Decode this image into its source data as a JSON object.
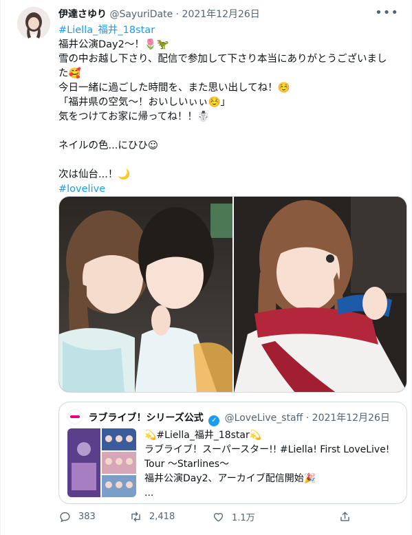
{
  "tweet": {
    "author": {
      "name": "伊達さゆり",
      "handle": "@SayuriDate",
      "separator": "·",
      "date": "2021年12月26日"
    },
    "body": [
      {
        "text": "#Liella_福井_18star",
        "type": "tag"
      },
      {
        "text": "福井公演Day2〜！🌷🦖",
        "type": "text"
      },
      {
        "text": "雪の中お越し下さり、配信で参加して下さり本当にありがとうございまし",
        "type": "text"
      },
      {
        "text": "た🥰",
        "type": "text"
      },
      {
        "text": "今日一緒に過ごした時間を、また思い出してね！☺️",
        "type": "text"
      },
      {
        "text": "「福井県の空気〜！おいしいぃぃ☺️」",
        "type": "text"
      },
      {
        "text": "気をつけてお家に帰ってね！！☃️",
        "type": "text"
      },
      {
        "text": "",
        "type": "text"
      },
      {
        "text": "ネイルの色...にひひ☺",
        "type": "text"
      },
      {
        "text": "",
        "type": "text"
      },
      {
        "text": "次は仙台...！🌙",
        "type": "text"
      },
      {
        "text": "#lovelive",
        "type": "tag"
      }
    ]
  },
  "quote": {
    "name": "ラブライブ！シリーズ公式",
    "verified": "✓",
    "handle": "@LoveLive_staff",
    "separator": "·",
    "date": "2021年12月26日",
    "lines": [
      "💫#Liella_福井_18star💫",
      "ラブライブ！スーパースター!! #Liella! First LoveLive!",
      "Tour 〜Starlines〜",
      "福井公演Day2、アーカイブ配信開始🎉",
      "..."
    ]
  },
  "actions": {
    "replies": "383",
    "retweets": "2,418",
    "likes": "1.1万"
  },
  "colors": {
    "accent": "#1d9bf0",
    "muted": "#536471",
    "border": "#cfd9de"
  }
}
